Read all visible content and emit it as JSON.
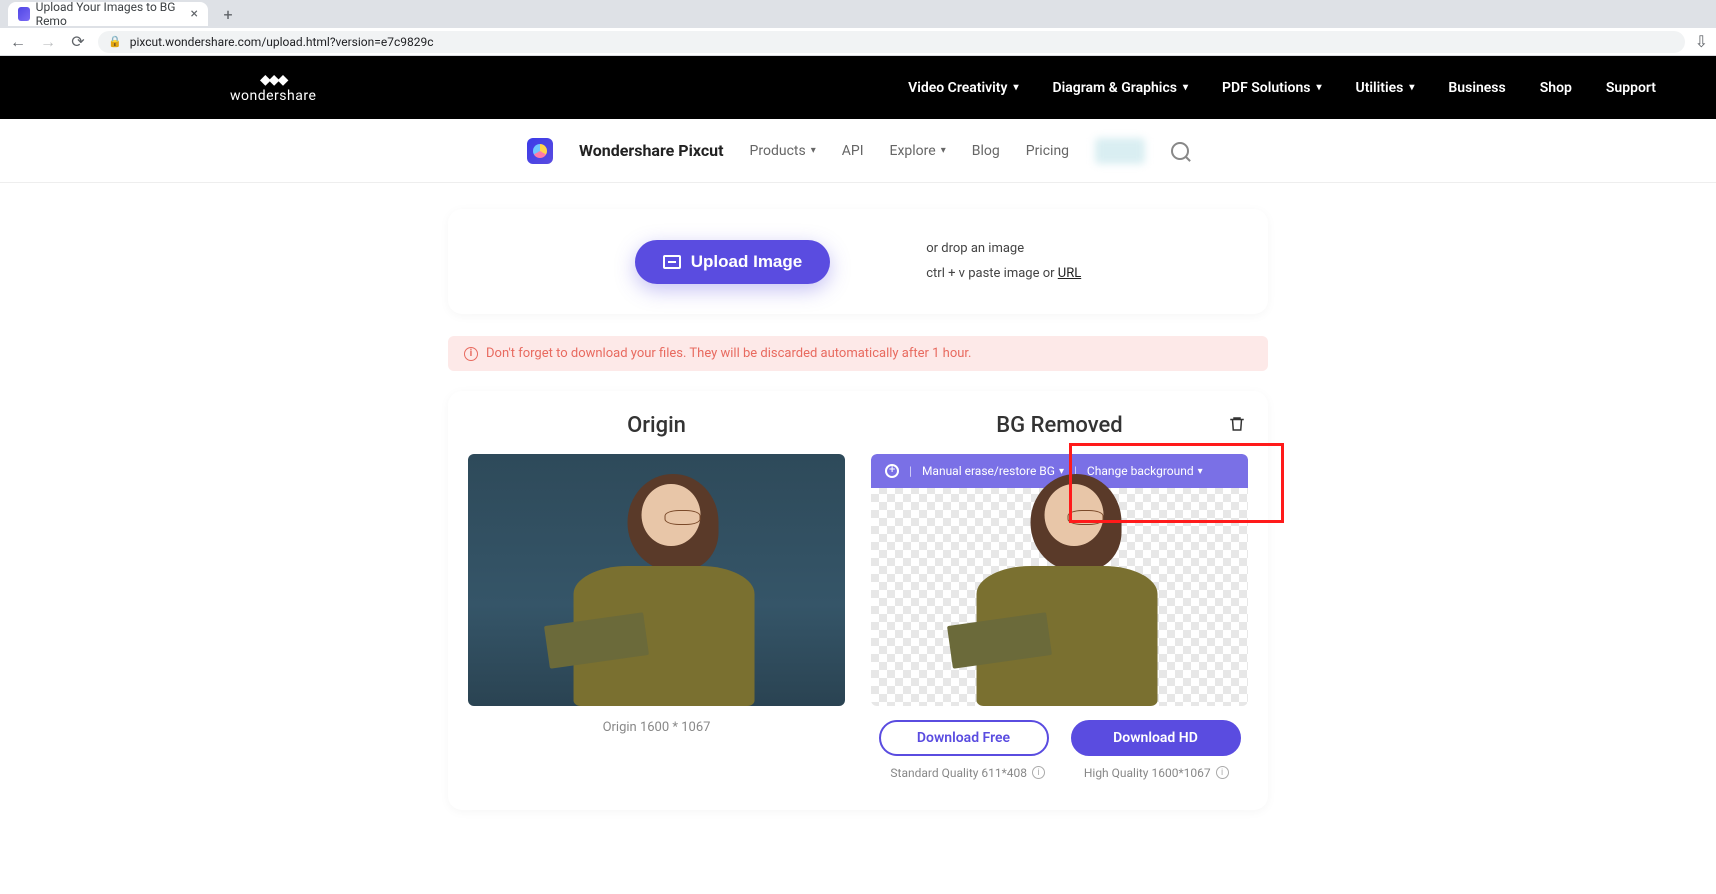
{
  "browser": {
    "tab_title": "Upload Your Images to BG Remo",
    "url": "pixcut.wondershare.com/upload.html?version=e7c9829c"
  },
  "topbar": {
    "logo_text": "wondershare",
    "menu": {
      "video": "Video Creativity",
      "diagram": "Diagram & Graphics",
      "pdf": "PDF Solutions",
      "utilities": "Utilities",
      "business": "Business",
      "shop": "Shop",
      "support": "Support"
    }
  },
  "subnav": {
    "brand": "Wondershare Pixcut",
    "products": "Products",
    "api": "API",
    "explore": "Explore",
    "blog": "Blog",
    "pricing": "Pricing"
  },
  "upload": {
    "button": "Upload Image",
    "drop_line": "or drop an image",
    "paste_prefix": "ctrl + v paste image or ",
    "url_label": "URL"
  },
  "warning": "Don't forget to download your files. They will be discarded automatically after 1 hour.",
  "result": {
    "origin_title": "Origin",
    "removed_title": "BG Removed",
    "toolbar": {
      "manual": "Manual erase/restore BG",
      "change_bg": "Change background"
    },
    "origin_caption": "Origin 1600 * 1067",
    "download_free": "Download Free",
    "download_hd": "Download HD",
    "standard_quality": "Standard Quality 611*408",
    "high_quality": "High Quality 1600*1067"
  }
}
